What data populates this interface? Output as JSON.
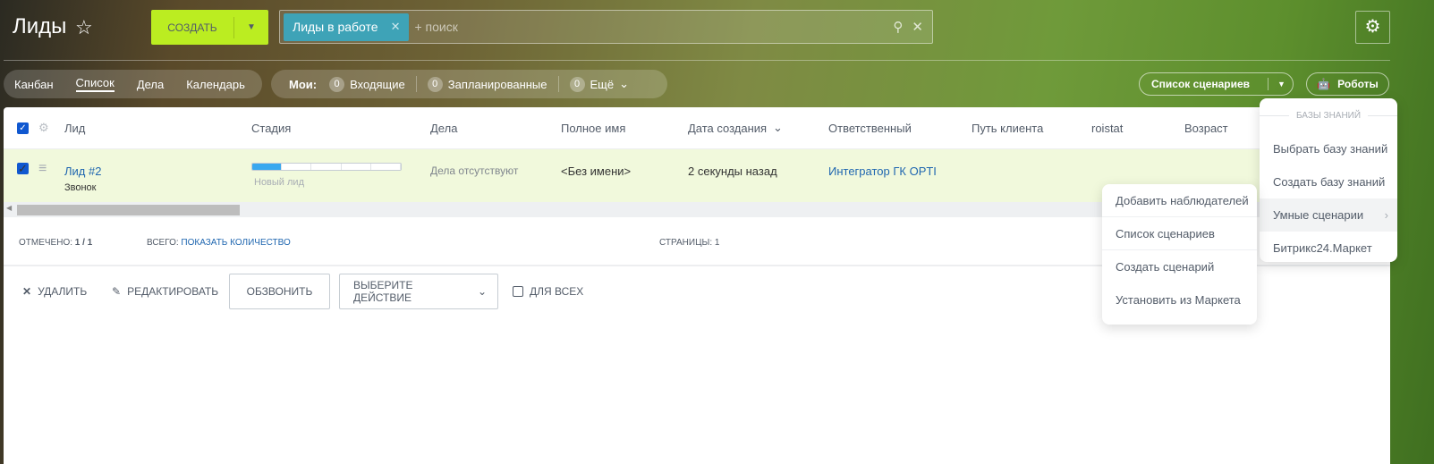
{
  "header": {
    "title": "Лиды",
    "create_label": "СОЗДАТЬ",
    "filter_tag": "Лиды в работе",
    "search_placeholder": "+ поиск"
  },
  "views": [
    "Канбан",
    "Список",
    "Дела",
    "Календарь"
  ],
  "counters": {
    "label": "Мои:",
    "items": [
      {
        "count": "0",
        "label": "Входящие"
      },
      {
        "count": "0",
        "label": "Запланированные"
      },
      {
        "count": "0",
        "label": "Ещё"
      }
    ]
  },
  "toolbar": {
    "scenarios": "Список сценариев",
    "robots": "Роботы"
  },
  "table": {
    "columns": [
      "Лид",
      "Стадия",
      "Дела",
      "Полное имя",
      "Дата создания",
      "Ответственный",
      "Путь клиента",
      "roistat",
      "Возраст"
    ],
    "row": {
      "title": "Лид #2",
      "source": "Звонок",
      "stage": "Новый лид",
      "stage_progress": "1/5",
      "deals": "Дела отсутствуют",
      "full_name": "<Без имени>",
      "created": "2 секунды назад",
      "responsible": "Интегратор ГК OPTI"
    }
  },
  "footer": {
    "checked_label": "Отмечено:",
    "checked_value": "1 / 1",
    "total_label": "Всего:",
    "total_link": "Показать количество",
    "pages_label": "Страницы:",
    "pages_value": "1"
  },
  "actions": {
    "delete": "Удалить",
    "edit": "Редактировать",
    "call": "Обзвонить",
    "select_action": "Выберите действие",
    "for_all": "Для всех"
  },
  "menu_main": {
    "header": "БАЗЫ ЗНАНИЙ",
    "items": [
      "Выбрать базу знаний",
      "Создать базу знаний",
      "Умные сценарии",
      "Битрикс24.Маркет"
    ]
  },
  "menu_sub": {
    "items": [
      "Добавить наблюдателей",
      "Список сценариев",
      "Создать сценарий",
      "Установить из Маркета"
    ]
  }
}
